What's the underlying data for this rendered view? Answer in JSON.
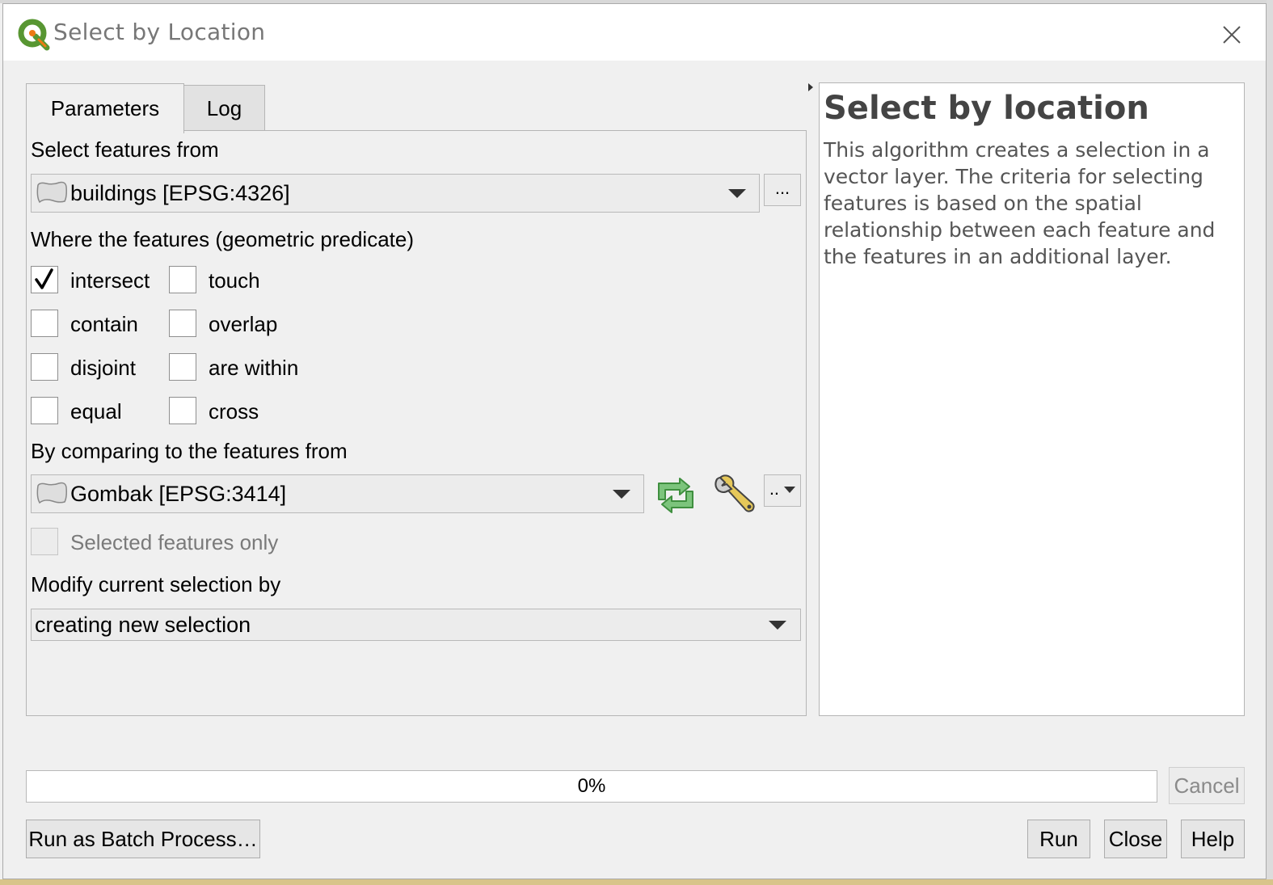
{
  "window": {
    "title": "Select by Location"
  },
  "tabs": [
    {
      "label": "Parameters",
      "active": true
    },
    {
      "label": "Log",
      "active": false
    }
  ],
  "params": {
    "input_label": "Select features from",
    "input_layer": "buildings [EPSG:4326]",
    "input_more_label": "...",
    "predicate_label": "Where the features (geometric predicate)",
    "predicates": [
      {
        "label": "intersect",
        "checked": true
      },
      {
        "label": "touch",
        "checked": false
      },
      {
        "label": "contain",
        "checked": false
      },
      {
        "label": "overlap",
        "checked": false
      },
      {
        "label": "disjoint",
        "checked": false
      },
      {
        "label": "are within",
        "checked": false
      },
      {
        "label": "equal",
        "checked": false
      },
      {
        "label": "cross",
        "checked": false
      }
    ],
    "compare_label": "By comparing to the features from",
    "compare_layer": "Gombak [EPSG:3414]",
    "compare_more_label": "..",
    "selected_only_label": "Selected features only",
    "selected_only_checked": false,
    "modify_label": "Modify current selection by",
    "modify_value": "creating new selection"
  },
  "help": {
    "title": "Select by location",
    "body": "This algorithm creates a selection in a vector layer. The criteria for selecting features is based on the spatial relationship between each feature and the features in an additional layer."
  },
  "progress": {
    "value": 0,
    "text": "0%"
  },
  "buttons": {
    "cancel": "Cancel",
    "batch": "Run as Batch Process…",
    "run": "Run",
    "close": "Close",
    "help": "Help"
  },
  "colors": {
    "qgis_green": "#589632",
    "qgis_yellow": "#ee7913",
    "check_mark": "#000000",
    "refresh_green": "#6fb36f"
  },
  "icons": {
    "title_logo": "qgis-logo-icon",
    "close": "close-icon",
    "layer": "polygon-layer-icon",
    "iterate": "iterate-refresh-icon",
    "advanced": "wrench-icon"
  }
}
